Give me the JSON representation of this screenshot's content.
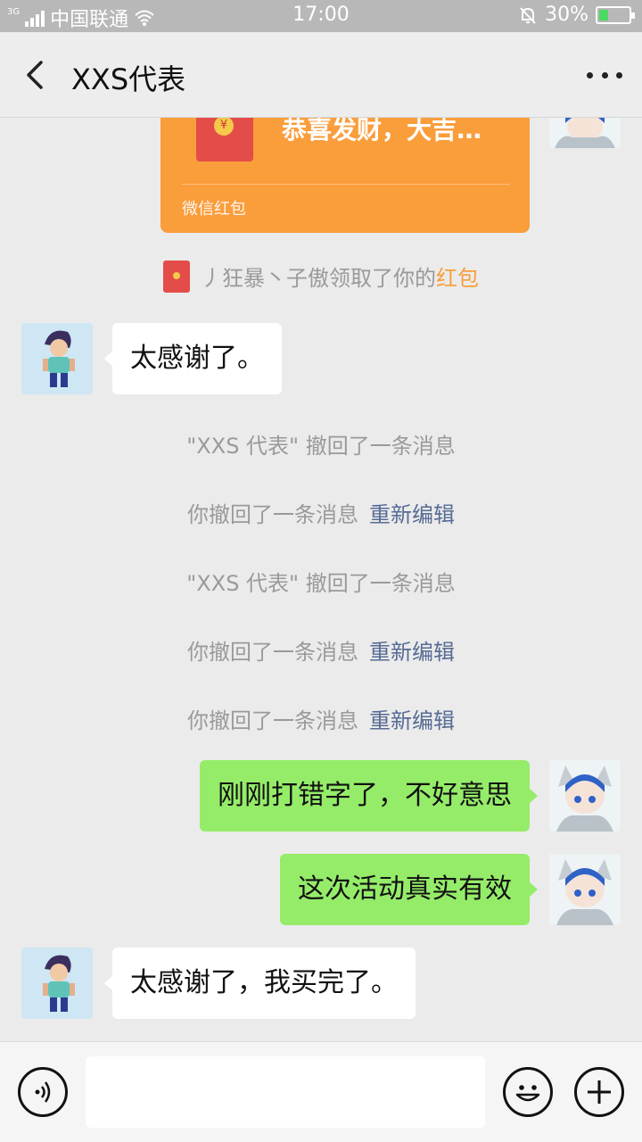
{
  "status_bar": {
    "network": "3G",
    "carrier": "中国联通",
    "time": "17:00",
    "battery": "30%",
    "battery_level": 0.3
  },
  "header": {
    "title": "XXS代表"
  },
  "messages": {
    "red_packet": {
      "text": "恭喜发财，大吉…",
      "label": "微信红包",
      "color": "#fa9d3b"
    },
    "red_packet_notice": {
      "text": "丿狂暴丶子傲领取了你的",
      "link": "红包"
    },
    "msg1": "太感谢了。",
    "recall1": "\"XXS 代表\" 撤回了一条消息",
    "recall2": "你撤回了一条消息",
    "recall2_link": "重新编辑",
    "recall3": "\"XXS 代表\" 撤回了一条消息",
    "recall4": "你撤回了一条消息",
    "recall4_link": "重新编辑",
    "recall5": "你撤回了一条消息",
    "recall5_link": "重新编辑",
    "msg2": "刚刚打错字了，不好意思",
    "msg3": "这次活动真实有效",
    "msg4": "太感谢了，我买完了。"
  },
  "input_bar": {
    "value": "",
    "placeholder": ""
  },
  "colors": {
    "outgoing_bubble": "#95ec69",
    "incoming_bubble": "#ffffff",
    "link": "#576b95"
  }
}
